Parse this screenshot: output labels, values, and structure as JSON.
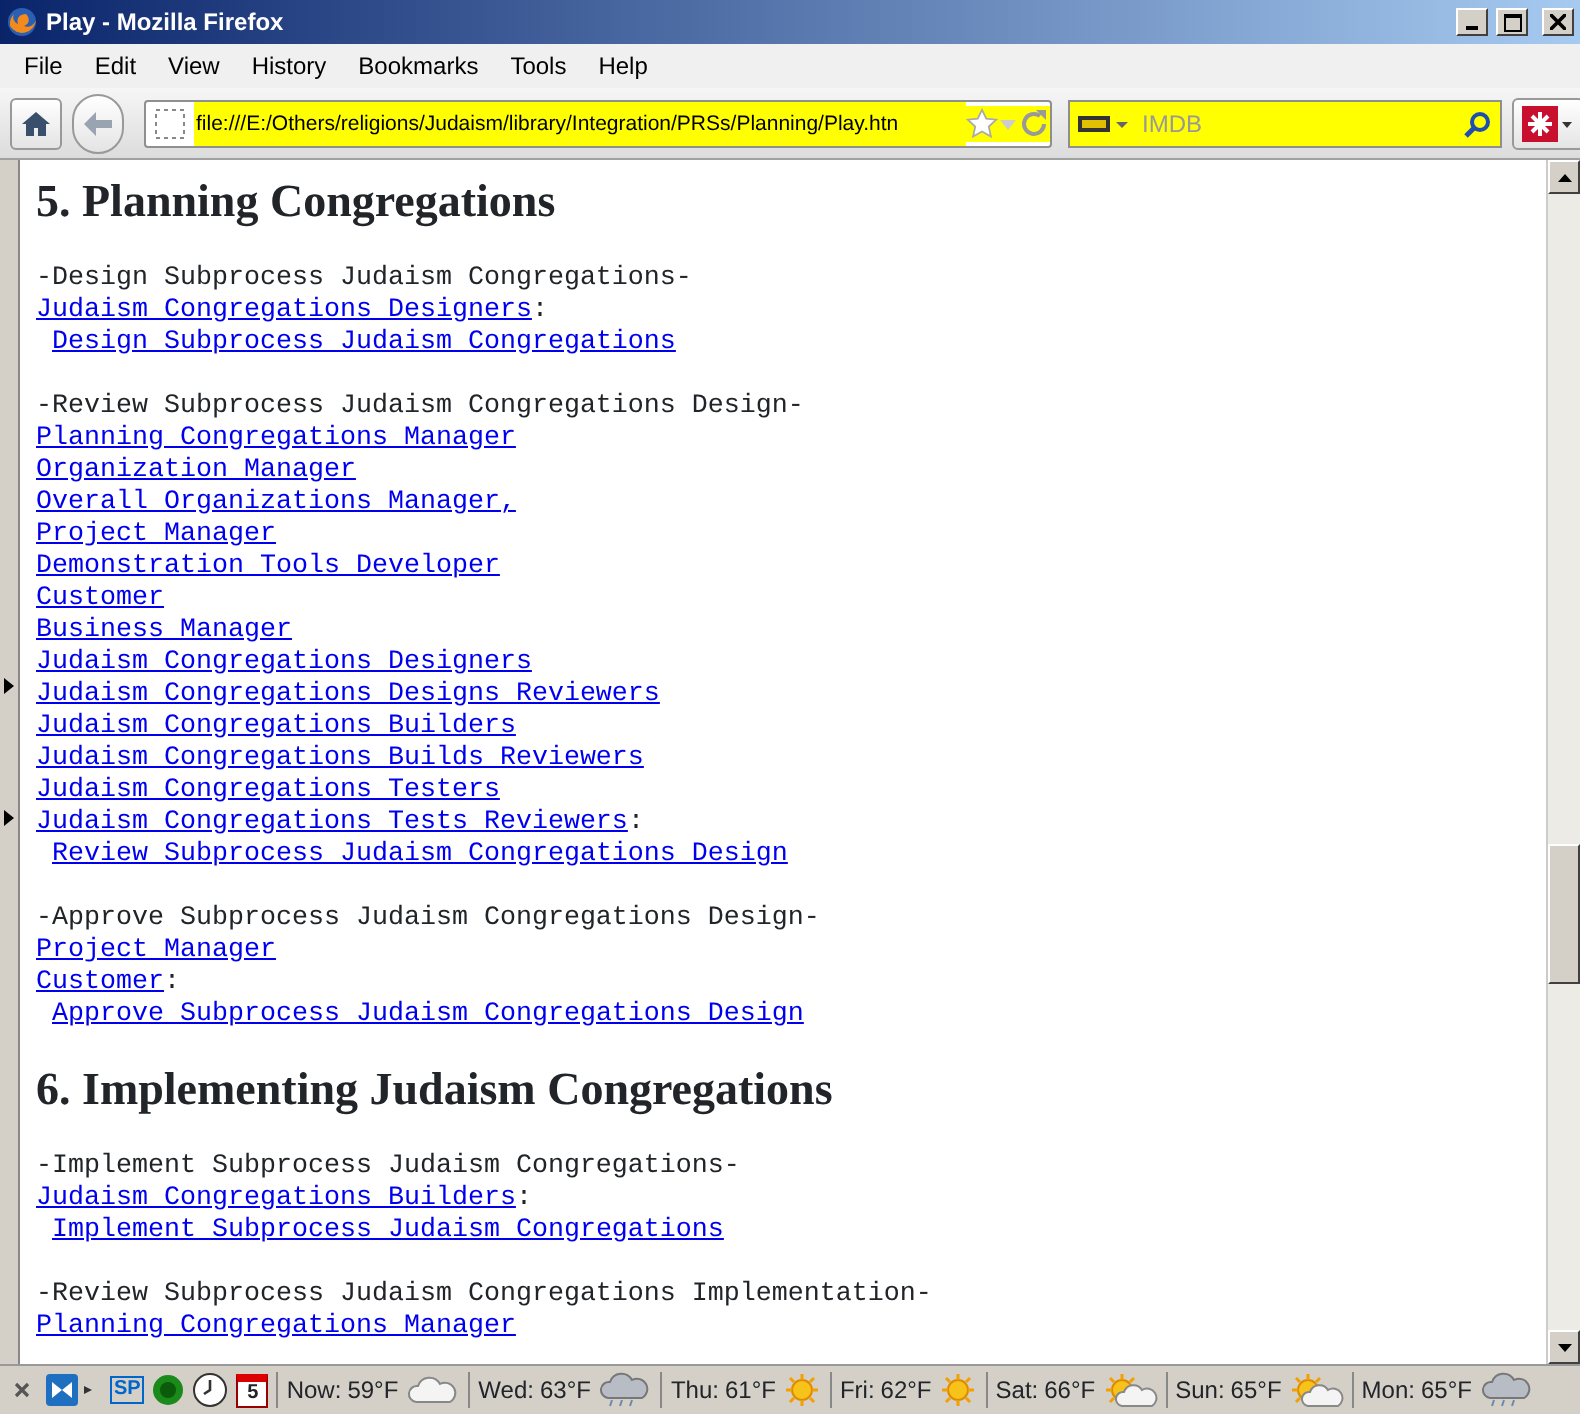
{
  "window": {
    "title": "Play - Mozilla Firefox"
  },
  "menu": [
    "File",
    "Edit",
    "View",
    "History",
    "Bookmarks",
    "Tools",
    "Help"
  ],
  "address": {
    "value": "file:///E:/Others/religions/Judaism/library/Integration/PRSs/Planning/Play.htn"
  },
  "search": {
    "placeholder": "IMDB"
  },
  "sections": [
    {
      "heading": "5. Planning Congregations",
      "blocks": [
        {
          "title": "-Design Subprocess Judaism Congregations-",
          "links": [
            "Judaism Congregations Designers"
          ],
          "suffix": ":",
          "task": "Design Subprocess Judaism Congregations"
        },
        {
          "title": "-Review Subprocess Judaism Congregations Design-",
          "links": [
            "Planning Congregations Manager",
            "Organization Manager",
            "Overall Organizations Manager,",
            "Project Manager",
            "Demonstration Tools Developer",
            "Customer",
            "Business Manager",
            "Judaism Congregations Designers",
            "Judaism Congregations Designs Reviewers",
            "Judaism Congregations Builders",
            "Judaism Congregations Builds Reviewers",
            "Judaism Congregations Testers",
            "Judaism Congregations Tests Reviewers"
          ],
          "suffix": ":",
          "task": "Review Subprocess Judaism Congregations Design"
        },
        {
          "title": "-Approve Subprocess Judaism Congregations Design-",
          "links": [
            "Project Manager",
            "Customer"
          ],
          "suffix": ":",
          "task": "Approve Subprocess Judaism Congregations Design"
        }
      ]
    },
    {
      "heading": "6. Implementing Judaism Congregations",
      "blocks": [
        {
          "title": "-Implement Subprocess Judaism Congregations-",
          "links": [
            "Judaism Congregations Builders"
          ],
          "suffix": ":",
          "task": "Implement Subprocess Judaism Congregations"
        },
        {
          "title": "-Review Subprocess Judaism Congregations Implementation-",
          "links": [
            "Planning Congregations Manager"
          ]
        }
      ]
    }
  ],
  "status_bar": {
    "calendar_day": "5",
    "sp": "SP",
    "weather": [
      {
        "label": "Now:",
        "temp": "59°F",
        "kind": "cloud"
      },
      {
        "label": "Wed:",
        "temp": "63°F",
        "kind": "rain"
      },
      {
        "label": "Thu:",
        "temp": "61°F",
        "kind": "sun"
      },
      {
        "label": "Fri:",
        "temp": "62°F",
        "kind": "sun"
      },
      {
        "label": "Sat:",
        "temp": "66°F",
        "kind": "partly"
      },
      {
        "label": "Sun:",
        "temp": "65°F",
        "kind": "partly"
      },
      {
        "label": "Mon:",
        "temp": "65°F",
        "kind": "rain"
      }
    ]
  }
}
